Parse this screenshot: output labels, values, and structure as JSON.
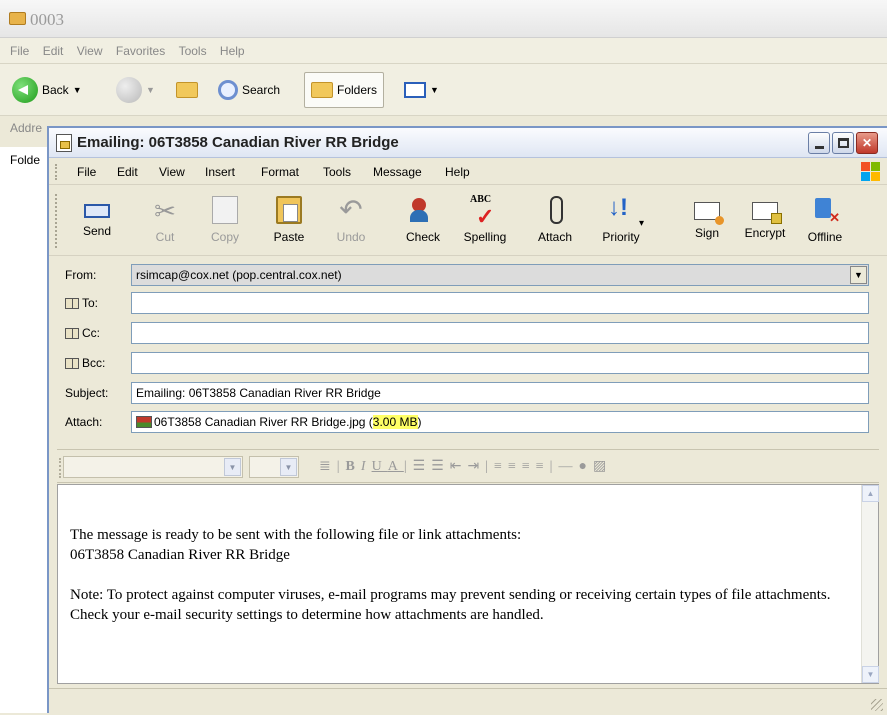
{
  "explorer": {
    "title": "0003",
    "menu": [
      "File",
      "Edit",
      "View",
      "Favorites",
      "Tools",
      "Help"
    ],
    "toolbar": {
      "back": "Back",
      "search": "Search",
      "folders": "Folders"
    },
    "address_label": "Addre",
    "folders_label": "Folde"
  },
  "email": {
    "title": "Emailing: 06T3858 Canadian River RR Bridge",
    "menu": [
      "File",
      "Edit",
      "View",
      "Insert",
      "Format",
      "Tools",
      "Message",
      "Help"
    ],
    "toolbar": [
      {
        "label": "Send",
        "icon": "send-icon",
        "enabled": true
      },
      {
        "label": "Cut",
        "icon": "cut-icon",
        "enabled": false
      },
      {
        "label": "Copy",
        "icon": "copy-icon",
        "enabled": false
      },
      {
        "label": "Paste",
        "icon": "paste-icon",
        "enabled": true
      },
      {
        "label": "Undo",
        "icon": "undo-icon",
        "enabled": false
      },
      {
        "label": "Check",
        "icon": "check-names-icon",
        "enabled": true
      },
      {
        "label": "Spelling",
        "icon": "spelling-icon",
        "enabled": true
      },
      {
        "label": "Attach",
        "icon": "paperclip-icon",
        "enabled": true
      },
      {
        "label": "Priority",
        "icon": "priority-icon",
        "enabled": true
      },
      {
        "label": "Sign",
        "icon": "sign-icon",
        "enabled": true
      },
      {
        "label": "Encrypt",
        "icon": "encrypt-icon",
        "enabled": true
      },
      {
        "label": "Offline",
        "icon": "offline-icon",
        "enabled": true
      }
    ],
    "spelling_abc": "ABC",
    "headers": {
      "from_label": "From:",
      "from_value": "rsimcap@cox.net   (pop.central.cox.net)",
      "to_label": "To:",
      "to_value": "",
      "cc_label": "Cc:",
      "cc_value": "",
      "bcc_label": "Bcc:",
      "bcc_value": "",
      "subject_label": "Subject:",
      "subject_value": "Emailing: 06T3858 Canadian River RR Bridge",
      "attach_label": "Attach:",
      "attach_name": "06T3858 Canadian River RR Bridge.jpg (",
      "attach_size": "3.00 MB",
      "attach_close": ")"
    },
    "body": {
      "line1": "The message is ready to be sent with the following file or link attachments:\n06T3858 Canadian River RR Bridge",
      "line2": "Note: To protect against computer viruses, e-mail programs may prevent sending or receiving certain types of file attachments.  Check your e-mail security settings to determine how attachments are handled."
    }
  },
  "colors": {
    "title_gradient_top": "#fafbfe",
    "close_button": "#c0392b",
    "highlight": "#ffff66"
  }
}
